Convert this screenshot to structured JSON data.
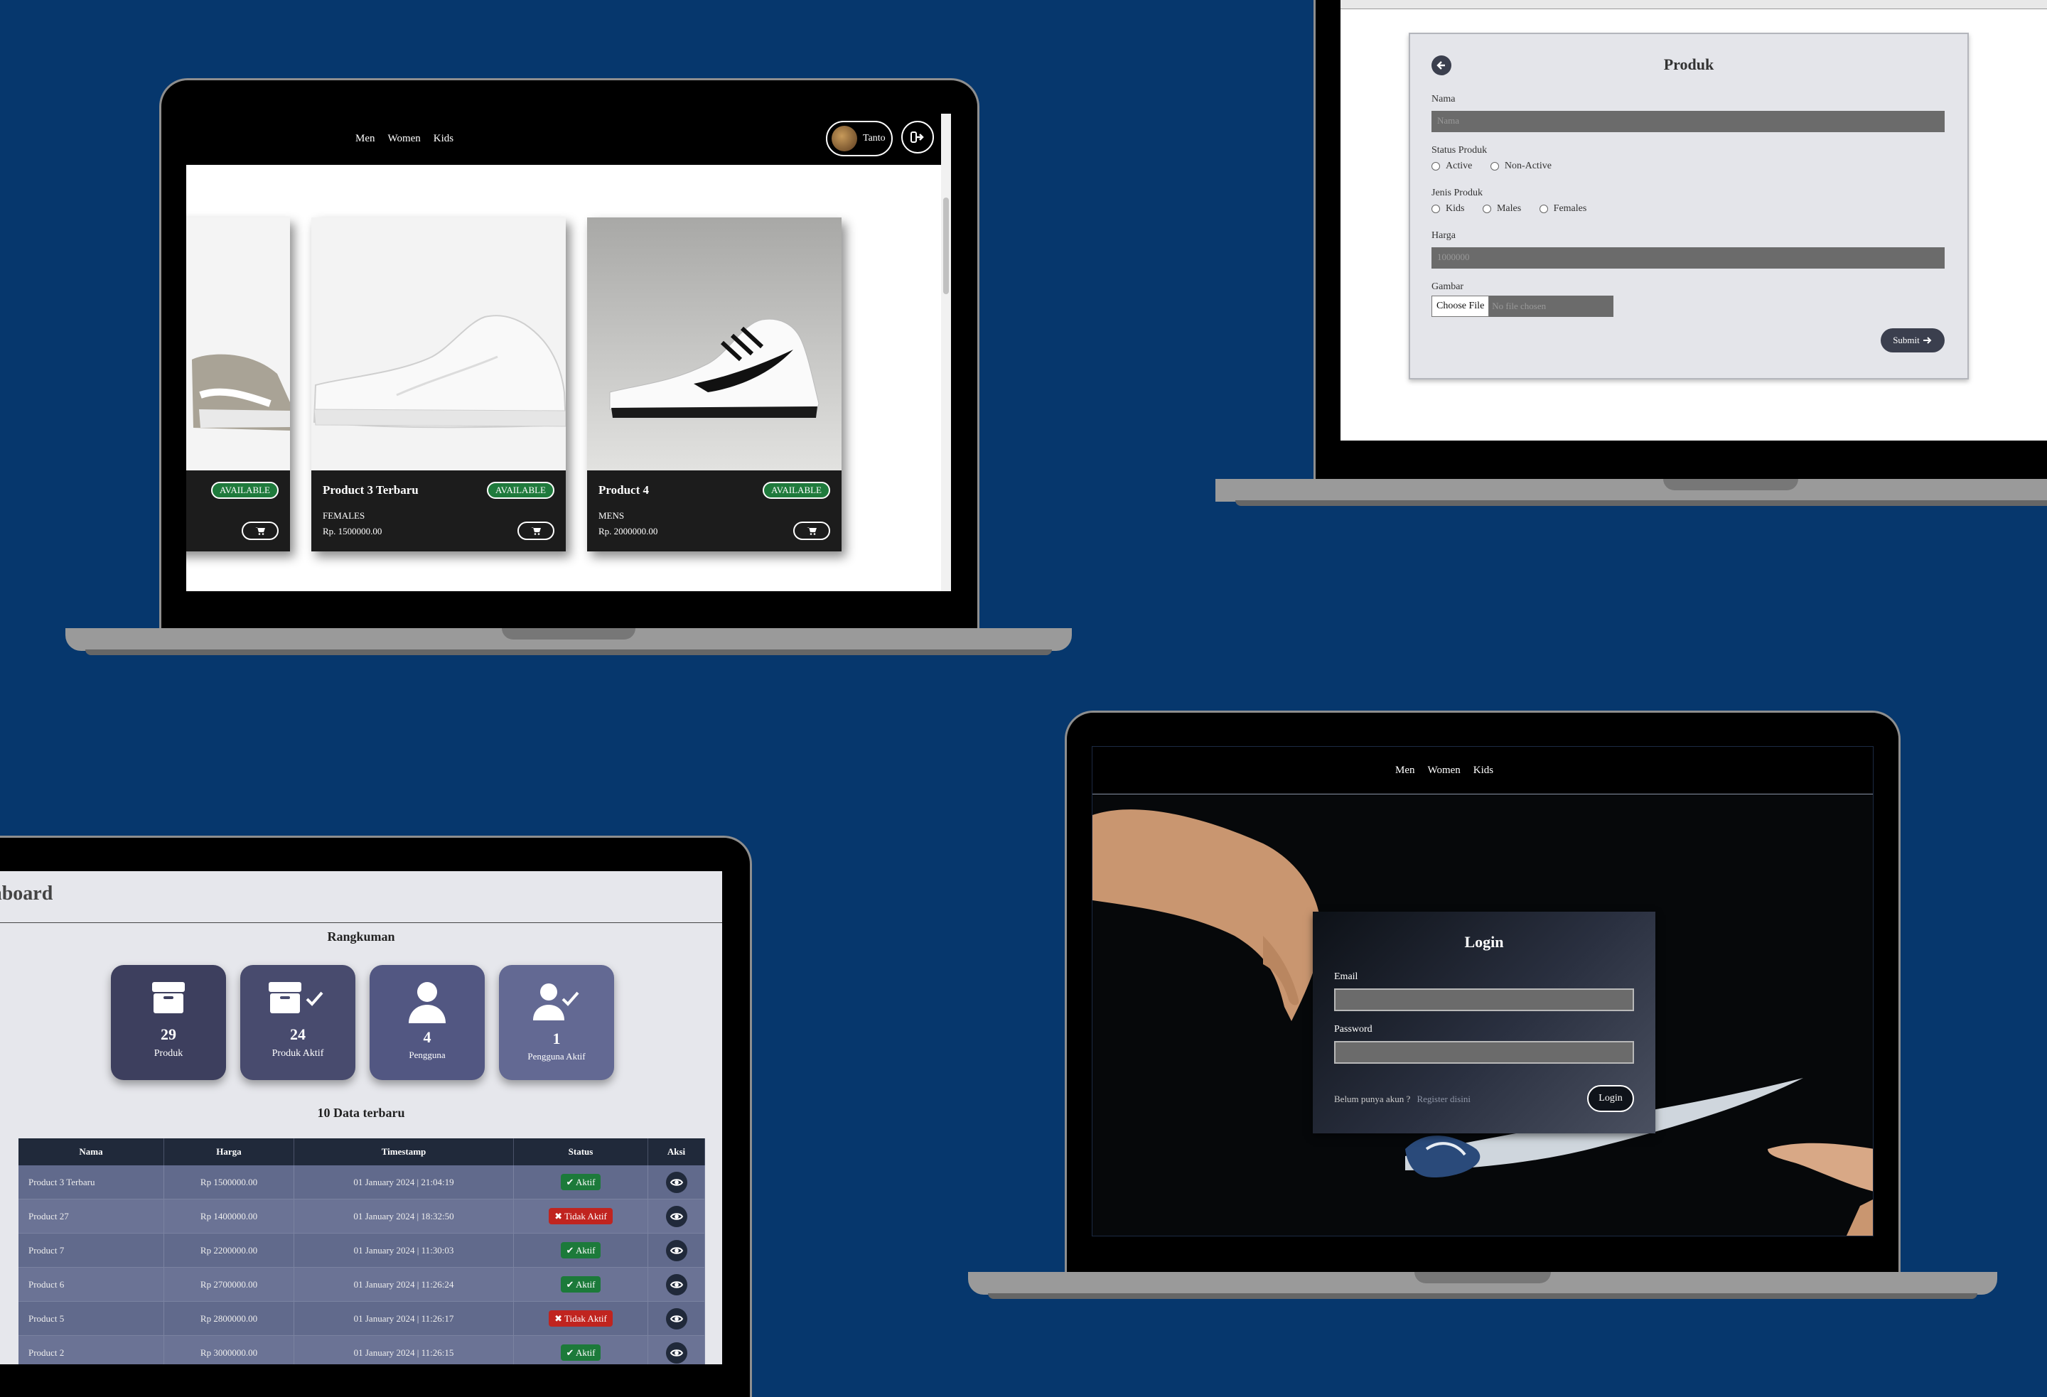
{
  "shop": {
    "nav": [
      "Men",
      "Women",
      "Kids"
    ],
    "user_name": "Tanto",
    "products": [
      {
        "name": "",
        "category": "",
        "price": "",
        "status": "AVAILABLE"
      },
      {
        "name": "Product 3 Terbaru",
        "category": "FEMALES",
        "price": "Rp. 1500000.00",
        "status": "AVAILABLE"
      },
      {
        "name": "Product 4",
        "category": "MENS",
        "price": "Rp. 2000000.00",
        "status": "AVAILABLE"
      }
    ]
  },
  "form": {
    "title": "Produk",
    "nama_label": "Nama",
    "nama_placeholder": "Nama",
    "status_label": "Status Produk",
    "status_options": [
      "Active",
      "Non-Active"
    ],
    "jenis_label": "Jenis Produk",
    "jenis_options": [
      "Kids",
      "Males",
      "Females"
    ],
    "harga_label": "Harga",
    "harga_placeholder": "1000000",
    "gambar_label": "Gambar",
    "file_button": "Choose File",
    "file_status": "No file chosen",
    "submit": "Submit"
  },
  "dashboard": {
    "title": "Dashboard",
    "summary_title": "Rangkuman",
    "stats": [
      {
        "value": "29",
        "label": "Produk",
        "color": "#3d3f5e"
      },
      {
        "value": "24",
        "label": "Produk Aktif",
        "color": "#484b6e"
      },
      {
        "value": "4",
        "label": "Pengguna",
        "color": "#525782"
      },
      {
        "value": "1",
        "label": "Pengguna Aktif",
        "color": "#636993"
      }
    ],
    "table_title": "10 Data terbaru",
    "columns": [
      "Nama",
      "Harga",
      "Timestamp",
      "Status",
      "Aksi"
    ],
    "rows": [
      {
        "nama": "Product 3 Terbaru",
        "harga": "Rp 1500000.00",
        "timestamp": "01 January 2024 | 21:04:19",
        "status": "Aktif",
        "active": true
      },
      {
        "nama": "Product 27",
        "harga": "Rp 1400000.00",
        "timestamp": "01 January 2024 | 18:32:50",
        "status": "Tidak Aktif",
        "active": false
      },
      {
        "nama": "Product 7",
        "harga": "Rp 2200000.00",
        "timestamp": "01 January 2024 | 11:30:03",
        "status": "Aktif",
        "active": true
      },
      {
        "nama": "Product 6",
        "harga": "Rp 2700000.00",
        "timestamp": "01 January 2024 | 11:26:24",
        "status": "Aktif",
        "active": true
      },
      {
        "nama": "Product 5",
        "harga": "Rp 2800000.00",
        "timestamp": "01 January 2024 | 11:26:17",
        "status": "Tidak Aktif",
        "active": false
      },
      {
        "nama": "Product 2",
        "harga": "Rp 3000000.00",
        "timestamp": "01 January 2024 | 11:26:15",
        "status": "Aktif",
        "active": true
      }
    ]
  },
  "login": {
    "nav": [
      "Men",
      "Women",
      "Kids"
    ],
    "title": "Login",
    "email_label": "Email",
    "password_label": "Password",
    "register_prompt": "Belum punya akun ?",
    "register_link": "Register disini",
    "button": "Login"
  },
  "colors": {
    "background": "#06376d",
    "available": "#1f7a3c",
    "active": "#1c7a3a",
    "inactive": "#c0241f"
  }
}
